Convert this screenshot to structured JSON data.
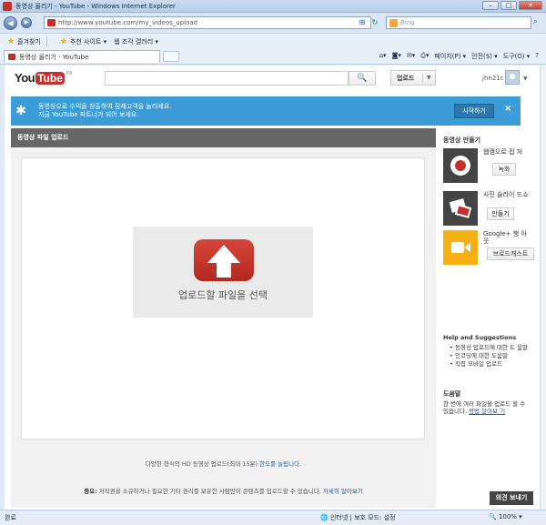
{
  "window": {
    "title": "동영상 올리기 - YouTube - Windows Internet Explorer",
    "controls": [
      "–",
      "□",
      "✕"
    ]
  },
  "browser": {
    "url": "http://www.youtube.com/my_videos_upload",
    "search_placeholder": "Bing",
    "favorites_label": "즐겨찾기",
    "suggested_sites": "추천 사이트 ▾",
    "web_slice": "웹 조각 갤러리 ▾",
    "tab_title": "동영상 올리기 - YouTube",
    "cmd_page": "페이지(P) ▾",
    "cmd_safety": "안전(S) ▾",
    "cmd_tools": "도구(O) ▾",
    "cmd_help": "?"
  },
  "youtube": {
    "logo_you": "You",
    "logo_tube": "Tube",
    "logo_region": "KR",
    "search_button": "🔍",
    "upload_label": "업로드",
    "username": "jhn21c",
    "banner_line1": "동영상으로 수익을 창출하여 잠재고객을 늘리세요.",
    "banner_line2": "지금 YouTube 파트너가 되어 보세요.",
    "banner_button": "시작하기",
    "banner_close": "×",
    "main_title": "동영상 파일 업로드",
    "select_file": "업로드할 파일을 선택",
    "note1_text": "다양한 형식의 HD 동영상 업로드(최대 15분) ",
    "note1_link": "한도를 늘립니다.",
    "note2_bold": "중요:",
    "note2_text": " 저작권을 소유하거나 필요한 기타 권리를 보유한 사람만이 콘텐츠를 업로드할 수 있습니다. ",
    "note2_link": "자세히 알아보기",
    "sidebar_title": "동영상 만들기",
    "create_items": [
      {
        "desc": "웹캠으로 접 처",
        "button": "녹화"
      },
      {
        "desc": "사진 슬라이 드쇼",
        "button": "만들기"
      },
      {
        "desc": "Google+ 행 아웃",
        "button": "브로드캐스트"
      }
    ],
    "help_title": "Help and Suggestions",
    "help_items": [
      "동영상 업로드에 대한 도 움말",
      "인코딩에 대한 도움말",
      "직접 모바일 업로드"
    ],
    "tip_title": "도움말",
    "tip_text": "한 번에 여러 파일을 업로드 할 수 있습니다. ",
    "tip_link": "방법 알아보 기",
    "feedback": "의견 보내기"
  },
  "status": {
    "done": "완료",
    "zone": "🌐 인터넷 | 보호 모드: 설정",
    "zoom": "🔍 100% ▾"
  }
}
